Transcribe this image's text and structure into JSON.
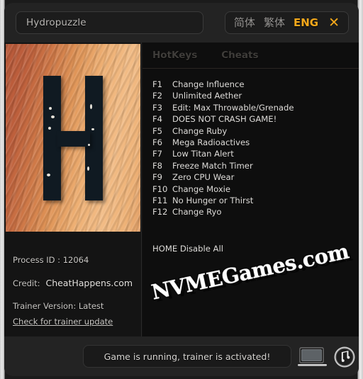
{
  "window": {
    "title_field_value": "Hydropuzzle"
  },
  "topbar": {
    "languages": [
      {
        "label": "简体",
        "name": "lang-simplified",
        "active": false
      },
      {
        "label": "繁体",
        "name": "lang-traditional",
        "active": false
      },
      {
        "label": "ENG",
        "name": "lang-english",
        "active": true
      }
    ],
    "close_label": "✕",
    "accent_color": "#f4a81b"
  },
  "tabs": [
    {
      "label": "HotKeys",
      "name": "tab-hotkeys"
    },
    {
      "label": "Cheats",
      "name": "tab-cheats"
    }
  ],
  "cheats": [
    {
      "key": "F1",
      "label": "Change Influence"
    },
    {
      "key": "F2",
      "label": "Unlimited Aether"
    },
    {
      "key": "F3",
      "label": "Edit: Max Throwable/Grenade"
    },
    {
      "key": "F4",
      "label": "DOES NOT CRASH GAME!"
    },
    {
      "key": "F5",
      "label": "Change Ruby"
    },
    {
      "key": "F6",
      "label": "Mega Radioactives"
    },
    {
      "key": "F7",
      "label": "Low Titan Alert"
    },
    {
      "key": "F8",
      "label": "Freeze Match Timer"
    },
    {
      "key": "F9",
      "label": "Zero CPU Wear"
    },
    {
      "key": "F10",
      "label": "Change Moxie"
    },
    {
      "key": "F11",
      "label": "No Hunger or Thirst"
    },
    {
      "key": "F12",
      "label": "Change Ryo"
    }
  ],
  "disable_all": "HOME Disable All",
  "info": {
    "process_id": "Process ID : 12064",
    "credit_label": "Credit:",
    "credit_value": "CheatHappens.com",
    "trainer_version": "Trainer Version: Latest",
    "update_link": "Check for trainer update"
  },
  "boxart": {
    "letter": "H"
  },
  "watermark": {
    "text": "NVMEGames.com"
  },
  "statusbar": {
    "message": "Game is running, trainer is activated!",
    "laptop_icon": "laptop-icon",
    "music_icon": "music-note-icon"
  }
}
